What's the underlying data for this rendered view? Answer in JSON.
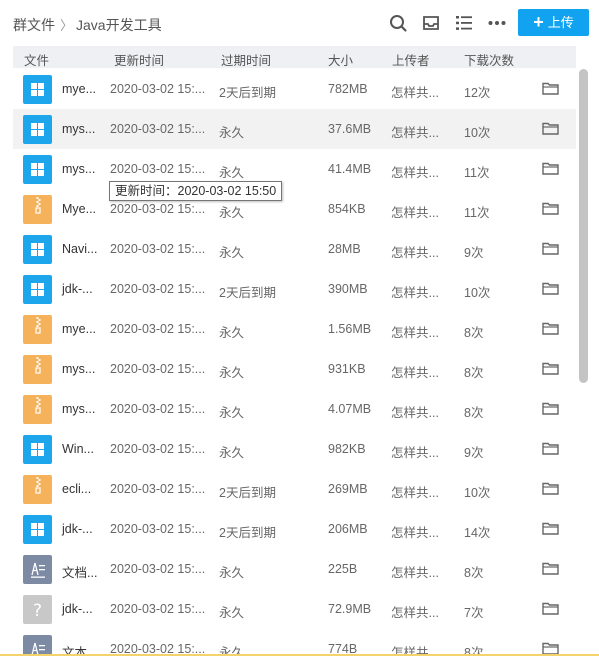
{
  "breadcrumb": {
    "root": "群文件",
    "separator": "〉",
    "current": "Java开发工具"
  },
  "toolbar": {
    "icons": [
      "search-icon",
      "inbox-icon",
      "list-view-icon",
      "more-icon"
    ],
    "upload_label": "上传"
  },
  "columns": {
    "name": "文件",
    "updated": "更新时间",
    "expires": "过期时间",
    "size": "大小",
    "uploader": "上传者",
    "downloads": "下载次数"
  },
  "tooltip": "更新时间：2020-03-02 15:50",
  "colors": {
    "accent": "#12a3f0",
    "exe_icon": "#1ea6ec",
    "archive_icon": "#f6b25b",
    "doc_icon": "#7d8aa4",
    "unknown_icon": "#c8c8c8"
  },
  "files": [
    {
      "type": "win",
      "name": "mye...",
      "updated": "2020-03-02 15:...",
      "expires": "2天后到期",
      "size": "782MB",
      "uploader": "怎样共...",
      "downloads": "12次"
    },
    {
      "type": "win",
      "name": "mys...",
      "updated": "2020-03-02 15:...",
      "expires": "永久",
      "size": "37.6MB",
      "uploader": "怎样共...",
      "downloads": "10次"
    },
    {
      "type": "win",
      "name": "mys...",
      "updated": "2020-03-02 15:...",
      "expires": "永久",
      "size": "41.4MB",
      "uploader": "怎样共...",
      "downloads": "11次"
    },
    {
      "type": "zip",
      "name": "Mye...",
      "updated": "2020-03-02 15:...",
      "expires": "永久",
      "size": "854KB",
      "uploader": "怎样共...",
      "downloads": "11次"
    },
    {
      "type": "win",
      "name": "Navi...",
      "updated": "2020-03-02 15:...",
      "expires": "永久",
      "size": "28MB",
      "uploader": "怎样共...",
      "downloads": "9次"
    },
    {
      "type": "win",
      "name": "jdk-...",
      "updated": "2020-03-02 15:...",
      "expires": "2天后到期",
      "size": "390MB",
      "uploader": "怎样共...",
      "downloads": "10次"
    },
    {
      "type": "zip",
      "name": "mye...",
      "updated": "2020-03-02 15:...",
      "expires": "永久",
      "size": "1.56MB",
      "uploader": "怎样共...",
      "downloads": "8次"
    },
    {
      "type": "zip",
      "name": "mys...",
      "updated": "2020-03-02 15:...",
      "expires": "永久",
      "size": "931KB",
      "uploader": "怎样共...",
      "downloads": "8次"
    },
    {
      "type": "zip",
      "name": "mys...",
      "updated": "2020-03-02 15:...",
      "expires": "永久",
      "size": "4.07MB",
      "uploader": "怎样共...",
      "downloads": "8次"
    },
    {
      "type": "win",
      "name": "Win...",
      "updated": "2020-03-02 15:...",
      "expires": "永久",
      "size": "982KB",
      "uploader": "怎样共...",
      "downloads": "9次"
    },
    {
      "type": "zip",
      "name": "ecli...",
      "updated": "2020-03-02 15:...",
      "expires": "2天后到期",
      "size": "269MB",
      "uploader": "怎样共...",
      "downloads": "10次"
    },
    {
      "type": "win",
      "name": "jdk-...",
      "updated": "2020-03-02 15:...",
      "expires": "2天后到期",
      "size": "206MB",
      "uploader": "怎样共...",
      "downloads": "14次"
    },
    {
      "type": "doc",
      "name": "文档...",
      "updated": "2020-03-02 15:...",
      "expires": "永久",
      "size": "225B",
      "uploader": "怎样共...",
      "downloads": "8次"
    },
    {
      "type": "unk",
      "name": "jdk-...",
      "updated": "2020-03-02 15:...",
      "expires": "永久",
      "size": "72.9MB",
      "uploader": "怎样共...",
      "downloads": "7次"
    },
    {
      "type": "doc",
      "name": "文本...",
      "updated": "2020-03-02 15:...",
      "expires": "永久",
      "size": "774B",
      "uploader": "怎样共...",
      "downloads": "8次"
    }
  ],
  "selected_index": 1
}
